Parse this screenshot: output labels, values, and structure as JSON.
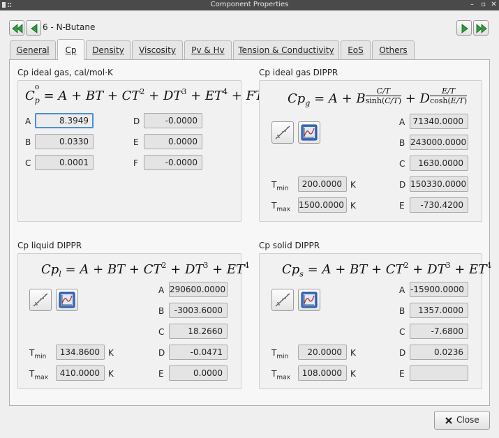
{
  "window": {
    "title": "Component Properties",
    "controls": [
      "–",
      "▫",
      "✕"
    ]
  },
  "header": {
    "component": "6 - N-Butane"
  },
  "tabs": [
    {
      "label": "General",
      "active": false
    },
    {
      "label": "Cp",
      "active": true
    },
    {
      "label": "Density",
      "active": false
    },
    {
      "label": "Viscosity",
      "active": false
    },
    {
      "label": "Pv & Hv",
      "active": false
    },
    {
      "label": "Tension & Conductivity",
      "active": false
    },
    {
      "label": "EoS",
      "active": false
    },
    {
      "label": "Others",
      "active": false
    }
  ],
  "ideal_gas": {
    "title": "Cp ideal gas, cal/mol·K",
    "coeffs": [
      {
        "label": "A",
        "value": "8.3949"
      },
      {
        "label": "B",
        "value": "0.0330"
      },
      {
        "label": "C",
        "value": "0.0001"
      },
      {
        "label": "D",
        "value": "-0.0000"
      },
      {
        "label": "E",
        "value": "0.0000"
      },
      {
        "label": "F",
        "value": "-0.0000"
      }
    ]
  },
  "ideal_gas_dippr": {
    "title": "Cp ideal gas DIPPR",
    "coeffs": [
      {
        "label": "A",
        "value": "71340.0000"
      },
      {
        "label": "B",
        "value": "243000.0000"
      },
      {
        "label": "C",
        "value": "1630.0000"
      },
      {
        "label": "D",
        "value": "150330.0000"
      },
      {
        "label": "E",
        "value": "-730.4200"
      }
    ],
    "tmin": "200.0000",
    "tmax": "1500.0000",
    "unit": "K"
  },
  "liquid_dippr": {
    "title": "Cp liquid DIPPR",
    "coeffs": [
      {
        "label": "A",
        "value": "290600.0000"
      },
      {
        "label": "B",
        "value": "-3003.6000"
      },
      {
        "label": "C",
        "value": "18.2660"
      },
      {
        "label": "D",
        "value": "-0.0471"
      },
      {
        "label": "E",
        "value": "0.0000"
      }
    ],
    "tmin": "134.8600",
    "tmax": "410.0000",
    "unit": "K"
  },
  "solid_dippr": {
    "title": "Cp solid DIPPR",
    "coeffs": [
      {
        "label": "A",
        "value": "-15900.0000"
      },
      {
        "label": "B",
        "value": "1357.0000"
      },
      {
        "label": "C",
        "value": "-7.6800"
      },
      {
        "label": "D",
        "value": "0.0236"
      },
      {
        "label": "E",
        "value": ""
      }
    ],
    "tmin": "20.0000",
    "tmax": "108.0000",
    "unit": "K"
  },
  "labels": {
    "tmin_sub": "min",
    "tmax_sub": "max",
    "T": "T"
  },
  "footer": {
    "close_label": "Close"
  },
  "colors": {
    "accent": "#4a90d9",
    "nav_green": "#2e9e3c",
    "titlebar": "#4a4a4a"
  }
}
